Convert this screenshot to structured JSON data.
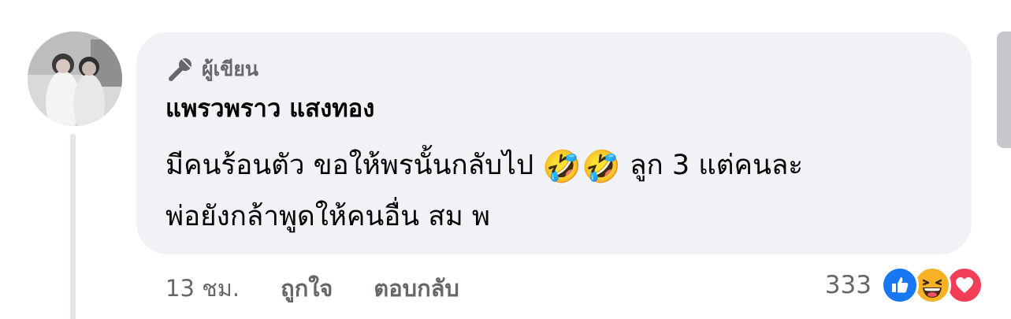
{
  "comment": {
    "author_badge": {
      "icon": "microphone-icon",
      "label": "ผู้เขียน"
    },
    "name": "แพรวพราว แสงทอง",
    "text_line_1a": "มีคนร้อนตัว ขอให้พรนั้นกลับไป",
    "emoji_1": "🤣",
    "emoji_2": "🤣",
    "text_line_1b": "ลูก 3 แต่คนละ",
    "text_line_2": "พ่อยังกล้าพูดให้คนอื่น สม พ"
  },
  "actions": {
    "time": "13 ชม.",
    "like_label": "ถูกใจ",
    "reply_label": "ตอบกลับ"
  },
  "reactions": {
    "count": "333",
    "icons": [
      "like-icon",
      "haha-icon",
      "love-icon"
    ]
  },
  "colors": {
    "bubble": "#f0f2f5",
    "text": "#050505",
    "secondary": "#65676b",
    "like": "#1877f2",
    "haha": "#f7b125",
    "love": "#f33e58"
  }
}
